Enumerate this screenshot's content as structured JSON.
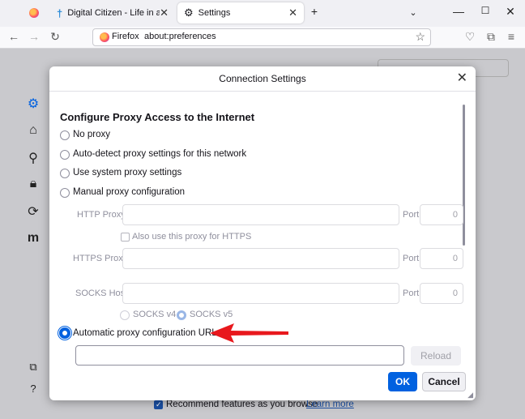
{
  "tabs": [
    {
      "label": ""
    },
    {
      "label": "Digital Citizen - Life in a digital"
    },
    {
      "label": "Settings"
    }
  ],
  "url": {
    "site": "Firefox",
    "address": "about:preferences"
  },
  "footer": {
    "recommend": "Recommend features as you browse",
    "learn_more": "Learn more"
  },
  "dialog": {
    "title": "Connection Settings",
    "heading": "Configure Proxy Access to the Internet",
    "options": {
      "no_proxy": "No proxy",
      "auto_detect": "Auto-detect proxy settings for this network",
      "system": "Use system proxy settings",
      "manual": "Manual proxy configuration",
      "auto_url": "Automatic proxy configuration URL"
    },
    "http_label": "HTTP Proxy",
    "https_label": "HTTPS Proxy",
    "socks_label": "SOCKS Host",
    "port_label": "Port",
    "port_value": "0",
    "also_https": "Also use this proxy for HTTPS",
    "socks_v4": "SOCKS v4",
    "socks_v5": "SOCKS v5",
    "pac_url": "",
    "reload": "Reload",
    "ok": "OK",
    "cancel": "Cancel"
  },
  "colors": {
    "accent": "#0061e0",
    "arrow": "#e8181d"
  }
}
